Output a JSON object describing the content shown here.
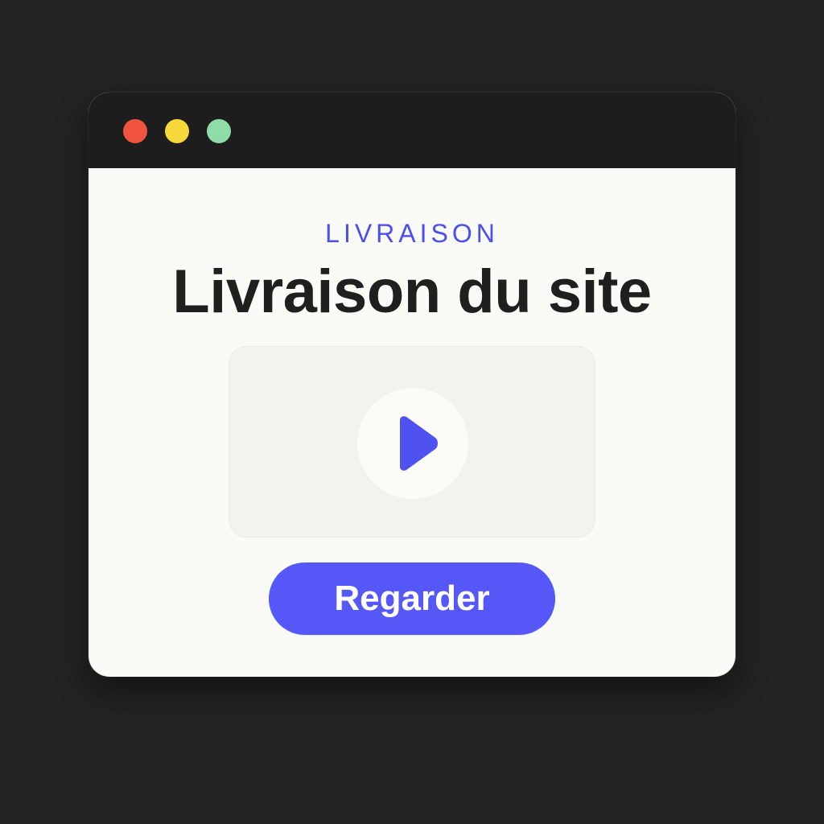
{
  "window": {
    "controls": [
      {
        "name": "close",
        "color": "#f0533f"
      },
      {
        "name": "minimize",
        "color": "#f6d83b"
      },
      {
        "name": "maximize",
        "color": "#8fdca8"
      }
    ]
  },
  "main": {
    "eyebrow": "LIVRAISON",
    "title": "Livraison du site",
    "video": {
      "icon": "play-icon"
    },
    "cta_label": "Regarder"
  },
  "colors": {
    "accent": "#5558f6",
    "eyebrow": "#4b4ff0",
    "play": "#5052f0",
    "titlebar": "#1d1d1d",
    "content_background": "#fafaf6",
    "page_background": "#232323"
  }
}
